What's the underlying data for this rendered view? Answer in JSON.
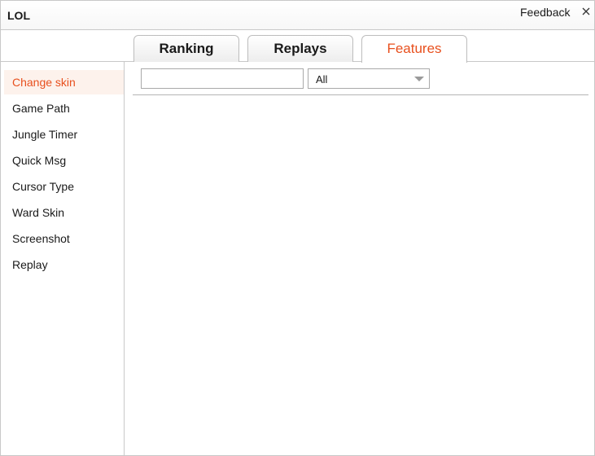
{
  "titlebar": {
    "title": "LOL",
    "feedback_label": "Feedback",
    "close_icon": "close-icon"
  },
  "tabs": [
    {
      "label": "Ranking",
      "active": false
    },
    {
      "label": "Replays",
      "active": false
    },
    {
      "label": "Features",
      "active": true
    }
  ],
  "sidebar": {
    "items": [
      {
        "label": "Change skin",
        "active": true
      },
      {
        "label": "Game Path",
        "active": false
      },
      {
        "label": "Jungle Timer",
        "active": false
      },
      {
        "label": "Quick Msg",
        "active": false
      },
      {
        "label": "Cursor Type",
        "active": false
      },
      {
        "label": "Ward Skin",
        "active": false
      },
      {
        "label": "Screenshot",
        "active": false
      },
      {
        "label": "Replay",
        "active": false
      }
    ]
  },
  "filter": {
    "search_value": "",
    "select_value": "All"
  },
  "colors": {
    "accent": "#e8501e",
    "active_bg": "#fdf2ec",
    "border": "#c8c8c8"
  }
}
